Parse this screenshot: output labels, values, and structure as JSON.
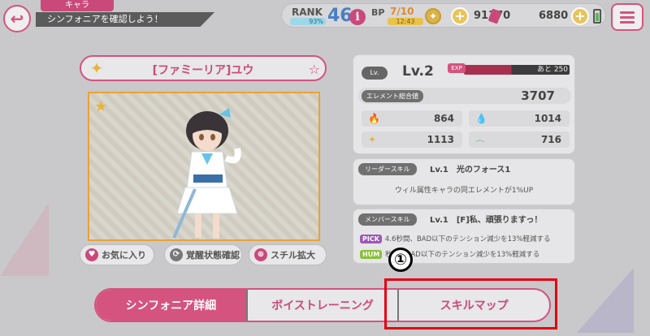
{
  "header": {
    "section": "キャラ",
    "subtitle": "シンフォニアを確認しよう！",
    "back_icon": "back-arrow-icon",
    "menu_icon": "menu-icon"
  },
  "status": {
    "rank_label": "RANK",
    "rank_pct": "93%",
    "rank_value": "46",
    "info": "i",
    "bp_label": "BP",
    "bp_value": "7/10",
    "bp_time": "12:43",
    "coins": "91370",
    "tickets": "6880"
  },
  "character": {
    "name": "[ファミーリア]ユウ"
  },
  "portrait_buttons": {
    "favorite": "お気に入り",
    "awakening": "覚醒状態確認",
    "zoom": "スチル拡大"
  },
  "level": {
    "badge": "Lv.",
    "value": "Lv.2",
    "exp_label": "EXP",
    "exp_remaining": "あと 250",
    "exp_fraction": 0.45
  },
  "element": {
    "label": "エレメント総合値",
    "total": "3707",
    "stats": [
      {
        "icon": "fire-icon",
        "value": "864",
        "color": "#d9534f"
      },
      {
        "icon": "water-icon",
        "value": "1014",
        "color": "#3b7dd8"
      },
      {
        "icon": "light-icon",
        "value": "1113",
        "color": "#e8b43a"
      },
      {
        "icon": "wind-icon",
        "value": "716",
        "color": "#5ab55a"
      }
    ]
  },
  "leader_skill": {
    "tag": "リーダースキル",
    "name": "Lv.1　光のフォース1",
    "desc": "ウィル属性キャラの同エレメントが1%UP"
  },
  "member_skill": {
    "tag": "メンバースキル",
    "name": "Lv.1　[F]私、頑張りますっ！",
    "line1_badge": "PICK",
    "line1": "4.6秒間、BAD以下のテンション減少を13%軽減する",
    "line2_badge": "HUM",
    "line2": "秒間、BAD以下のテンション減少を13%軽減する"
  },
  "annotation": "①",
  "tabs": [
    {
      "label": "シンフォニア詳細",
      "active": true
    },
    {
      "label": "ボイストレーニング",
      "active": false
    },
    {
      "label": "スキルマップ",
      "active": false
    }
  ]
}
